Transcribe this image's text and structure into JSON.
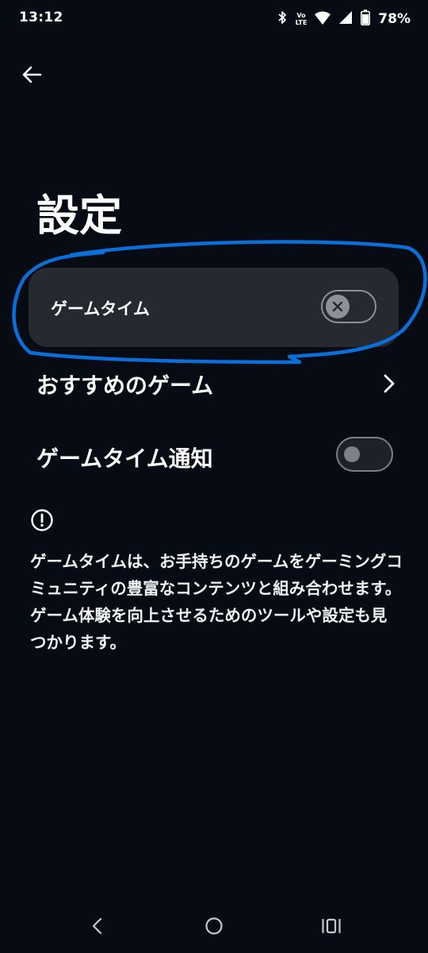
{
  "status_bar": {
    "time": "13:12",
    "volte_top": "Vo",
    "volte_bottom": "LTE",
    "battery_percent": "78%",
    "icons": [
      "bluetooth-icon",
      "volte-icon",
      "wifi-icon",
      "signal-icon",
      "battery-icon"
    ]
  },
  "header": {
    "back_icon": "back-arrow-icon",
    "title": "設定"
  },
  "settings": {
    "game_time": {
      "label": "ゲームタイム",
      "enabled": false
    },
    "recommended_games": {
      "label": "おすすめのゲーム"
    },
    "game_time_notification": {
      "label": "ゲームタイム通知",
      "enabled": false
    }
  },
  "info": {
    "icon": "info-icon",
    "text": "ゲームタイムは、お手持ちのゲームをゲーミングコミュニティの豊富なコンテンツと組み合わせます。ゲーム体験を向上させるためのツールや設定も見つかります。"
  },
  "colors": {
    "background": "#070b13",
    "card": "#262930",
    "highlight": "#0a6fd8",
    "toggle_off": "#8d9099"
  },
  "nav_bar": {
    "icons": [
      "nav-back-icon",
      "nav-home-icon",
      "nav-recents-icon"
    ]
  }
}
